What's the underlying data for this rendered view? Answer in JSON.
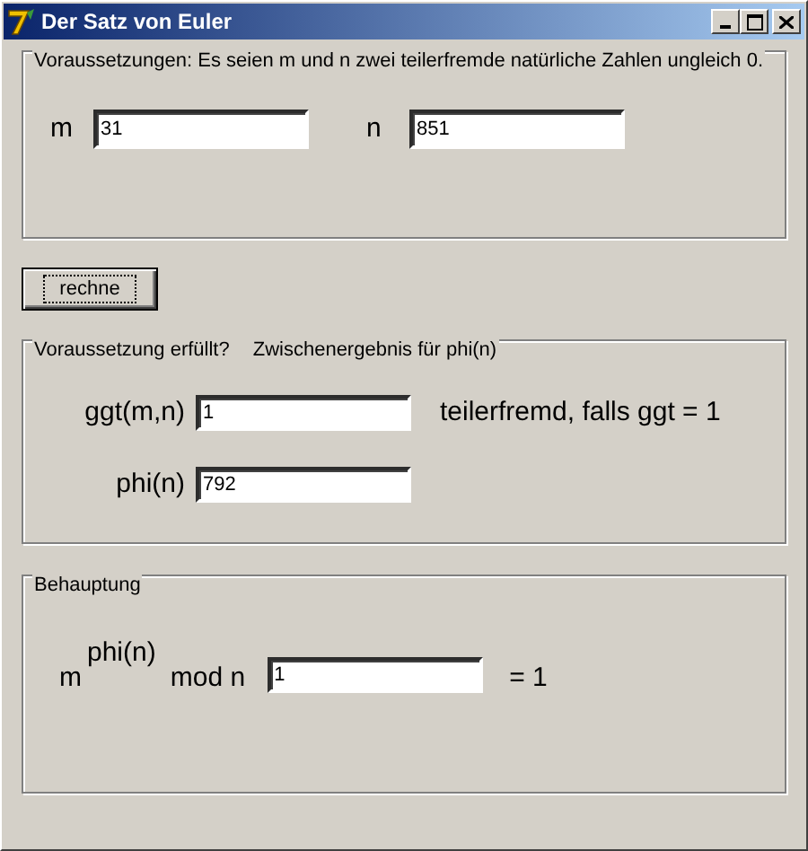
{
  "window": {
    "title": "Der Satz von Euler"
  },
  "premises": {
    "legend": "Voraussetzungen: Es seien m und n zwei teilerfremde natürliche Zahlen ungleich 0.",
    "fields": [
      {
        "label": "m",
        "value": "31"
      },
      {
        "label": "n",
        "value": "851"
      }
    ]
  },
  "compute_button": {
    "label": "rechne",
    "focused": true
  },
  "check": {
    "legend_parts": [
      "Voraussetzung erfüllt?",
      "Zwischenergebnis für phi(n)"
    ],
    "rows": [
      {
        "label": "ggt(m,n)",
        "value": "1",
        "note": "teilerfremd, falls ggt = 1"
      },
      {
        "label": "phi(n)",
        "value": "792"
      }
    ]
  },
  "claim": {
    "legend": "Behauptung",
    "base": "m",
    "exponent": "phi(n)",
    "operator": "mod n",
    "value": "1",
    "result": "= 1"
  }
}
